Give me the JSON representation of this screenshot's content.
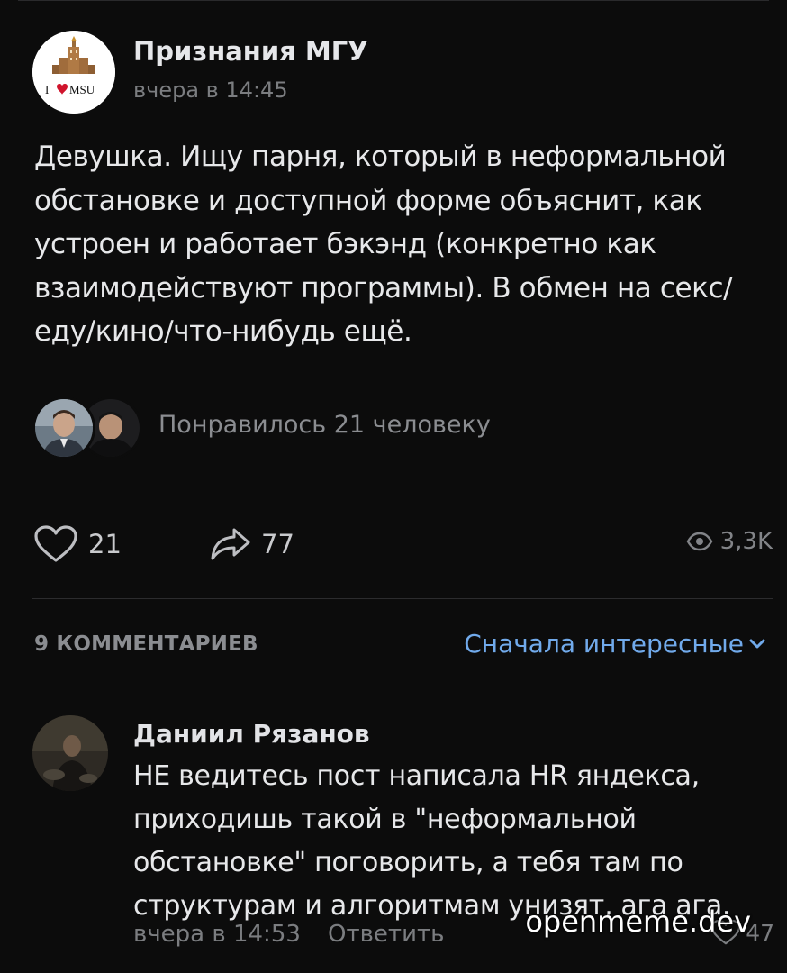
{
  "post": {
    "group_name": "Признания МГУ",
    "time": "вчера в 14:45",
    "avatar_label": "I ♥ MSU",
    "text": "Девушка. Ищу парня, который в неформальной\nобстановке и доступной форме объяснит, как\nустроен и работает бэкэнд (конкретно как\nвзаимодействуют программы). В обмен на секс/\nеду/кино/что-нибудь ещё.",
    "liked_by": "Понравилось 21 человеку",
    "likes": "21",
    "shares": "77",
    "views": "3,3K"
  },
  "comments": {
    "count_label": "9 КОММЕНТАРИЕВ",
    "sort_label": "Сначала интересные",
    "items": [
      {
        "author": "Даниил Рязанов",
        "text": "НЕ ведитесь пост написала HR яндекса, приходишь такой в \"неформальной обстановке\" поговорить, а тебя там по структурам и алгоритмам унизят, ага ага.",
        "time": "вчера в 14:53",
        "reply_label": "Ответить",
        "likes": "47"
      }
    ]
  },
  "watermark": "openmeme.dev",
  "colors": {
    "background": "#0c0c0c",
    "accent": "#71aaeb",
    "secondary_text": "#7b7d80",
    "heart": "#d0142c"
  }
}
